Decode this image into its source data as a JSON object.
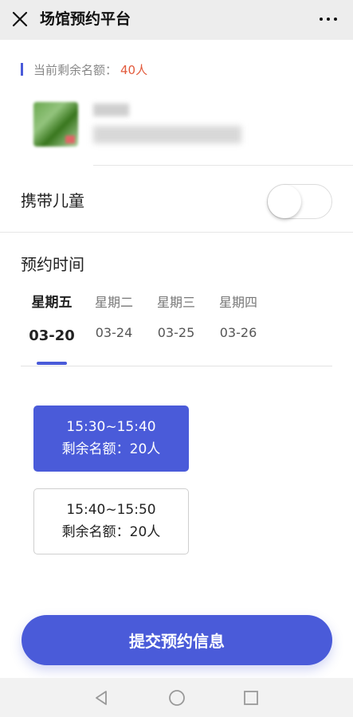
{
  "header": {
    "title": "场馆预约平台",
    "close_icon": "close-icon",
    "more_icon": "more-icon"
  },
  "quota": {
    "label": "当前剩余名额：",
    "value": "40人",
    "value_color": "#e25a3c"
  },
  "children": {
    "label": "携带儿童",
    "enabled": false
  },
  "booking": {
    "title": "预约时间",
    "days": [
      {
        "weekday": "星期五",
        "date": "03-20",
        "selected": true
      },
      {
        "weekday": "星期二",
        "date": "03-24",
        "selected": false
      },
      {
        "weekday": "星期三",
        "date": "03-25",
        "selected": false
      },
      {
        "weekday": "星期四",
        "date": "03-26",
        "selected": false
      }
    ],
    "slots": [
      {
        "time": "15:30~15:40",
        "remaining": "剩余名额：20人",
        "selected": true
      },
      {
        "time": "15:40~15:50",
        "remaining": "剩余名额：20人",
        "selected": false
      }
    ]
  },
  "submit_label": "提交预约信息",
  "colors": {
    "accent": "#4a5bd9",
    "topbar_bg": "#ededed"
  },
  "navbar": {
    "icons": [
      "back-icon",
      "home-icon",
      "recent-apps-icon"
    ]
  }
}
